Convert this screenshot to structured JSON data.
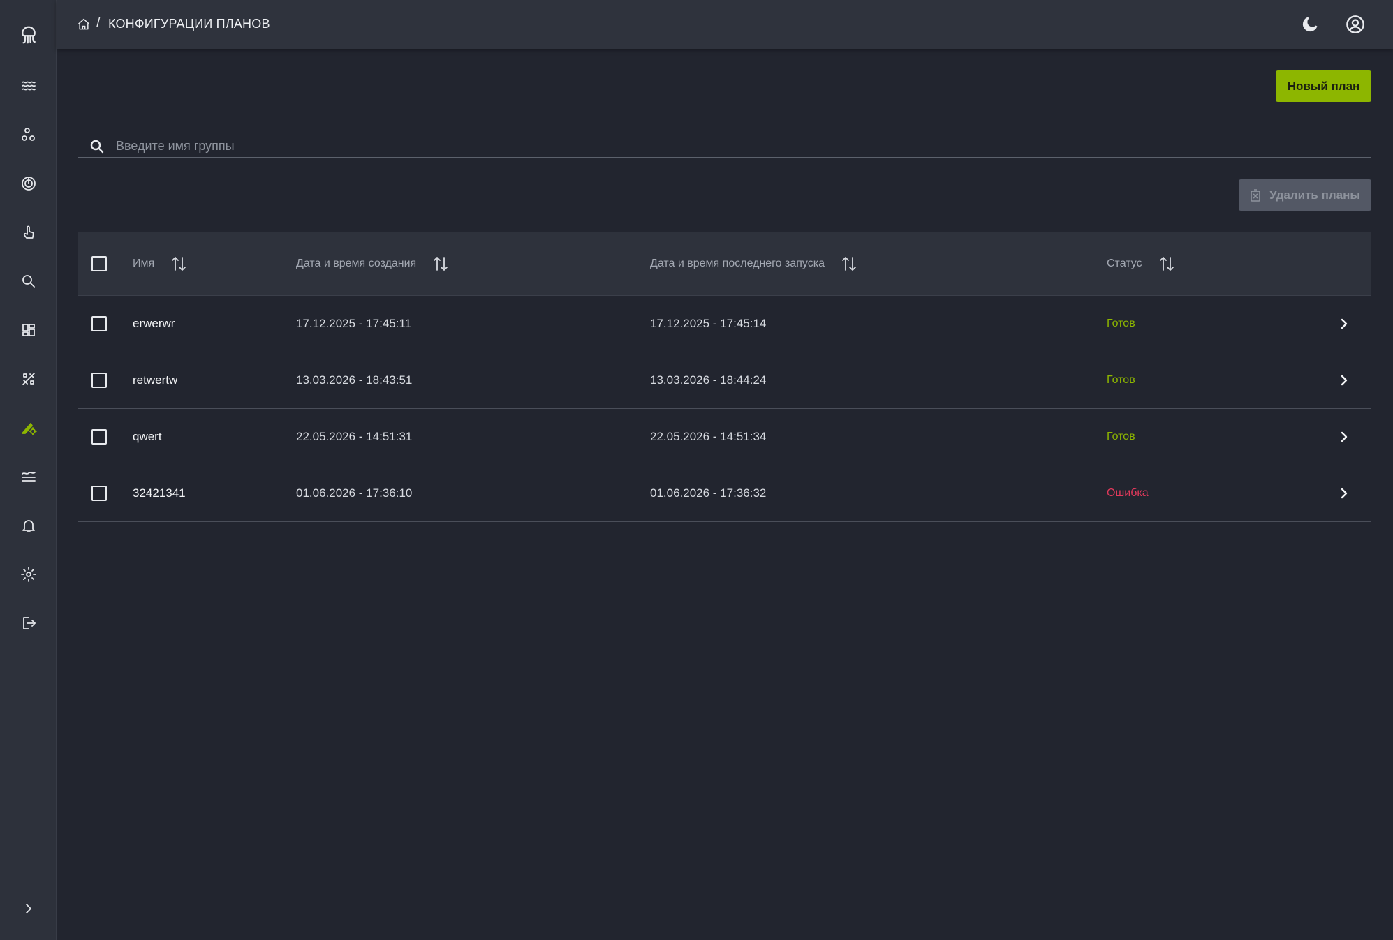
{
  "app": {
    "accent_color": "#8db600",
    "error_color": "#e0395b"
  },
  "breadcrumb": {
    "separator": "/",
    "title": "КОНФИГУРАЦИИ ПЛАНОВ"
  },
  "sidebar": {
    "items": [
      {
        "icon": "jellyfish-logo-icon"
      },
      {
        "icon": "waves-icon"
      },
      {
        "icon": "nodes-icon"
      },
      {
        "icon": "target-icon"
      },
      {
        "icon": "pointer-hand-icon"
      },
      {
        "icon": "search-icon"
      },
      {
        "icon": "dashboard-icon"
      },
      {
        "icon": "patch-icon"
      },
      {
        "icon": "plan-config-icon",
        "active": true
      },
      {
        "icon": "layers-icon"
      },
      {
        "icon": "bell-icon"
      },
      {
        "icon": "gear-icon"
      },
      {
        "icon": "logout-icon"
      },
      {
        "icon": "chevron-right-icon"
      }
    ]
  },
  "toolbar": {
    "new_plan_label": "Новый план",
    "delete_plans_label": "Удалить планы"
  },
  "search": {
    "placeholder": "Введите имя группы",
    "value": ""
  },
  "table": {
    "columns": [
      {
        "label": "Имя"
      },
      {
        "label": "Дата и время создания"
      },
      {
        "label": "Дата и время последнего запуска"
      },
      {
        "label": "Статус"
      }
    ],
    "rows": [
      {
        "name": "erwerwr",
        "created": "17.12.2025 - 17:45:11",
        "last_run": "17.12.2025 - 17:45:14",
        "status": "Готов",
        "status_kind": "ok"
      },
      {
        "name": "retwertw",
        "created": "13.03.2026 - 18:43:51",
        "last_run": "13.03.2026 - 18:44:24",
        "status": "Готов",
        "status_kind": "ok"
      },
      {
        "name": "qwert",
        "created": "22.05.2026 - 14:51:31",
        "last_run": "22.05.2026 - 14:51:34",
        "status": "Готов",
        "status_kind": "ok"
      },
      {
        "name": "32421341",
        "created": "01.06.2026 - 17:36:10",
        "last_run": "01.06.2026 - 17:36:32",
        "status": "Ошибка",
        "status_kind": "error"
      }
    ]
  }
}
